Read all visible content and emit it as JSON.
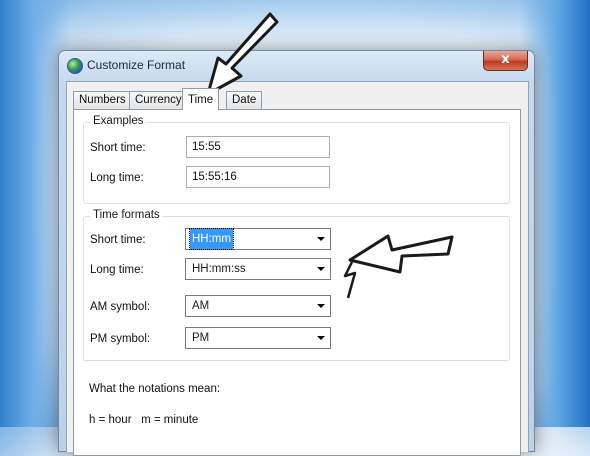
{
  "window": {
    "title": "Customize Format",
    "close_glyph": "x"
  },
  "tabs": [
    {
      "label": "Numbers"
    },
    {
      "label": "Currency"
    },
    {
      "label": "Time"
    },
    {
      "label": "Date"
    }
  ],
  "active_tab": "Time",
  "examples": {
    "group_title": "Examples",
    "short_time_label": "Short time:",
    "short_time_value": "15:55",
    "long_time_label": "Long time:",
    "long_time_value": "15:55:16"
  },
  "time_formats": {
    "group_title": "Time formats",
    "short_time_label": "Short time:",
    "short_time_value": "HH:mm",
    "long_time_label": "Long time:",
    "long_time_value": "HH:mm:ss",
    "am_label": "AM symbol:",
    "am_value": "AM",
    "pm_label": "PM symbol:",
    "pm_value": "PM"
  },
  "notation": {
    "heading": "What the notations mean:",
    "line1": "h = hour   m = minute"
  },
  "icons": {
    "title_icon": "globe-icon",
    "close_icon": "close-icon",
    "dropdown_icon": "chevron-down-icon"
  },
  "colors": {
    "selection": "#3399ff",
    "close_button": "#c0391f",
    "desktop_blue": "#2f7fd0"
  }
}
